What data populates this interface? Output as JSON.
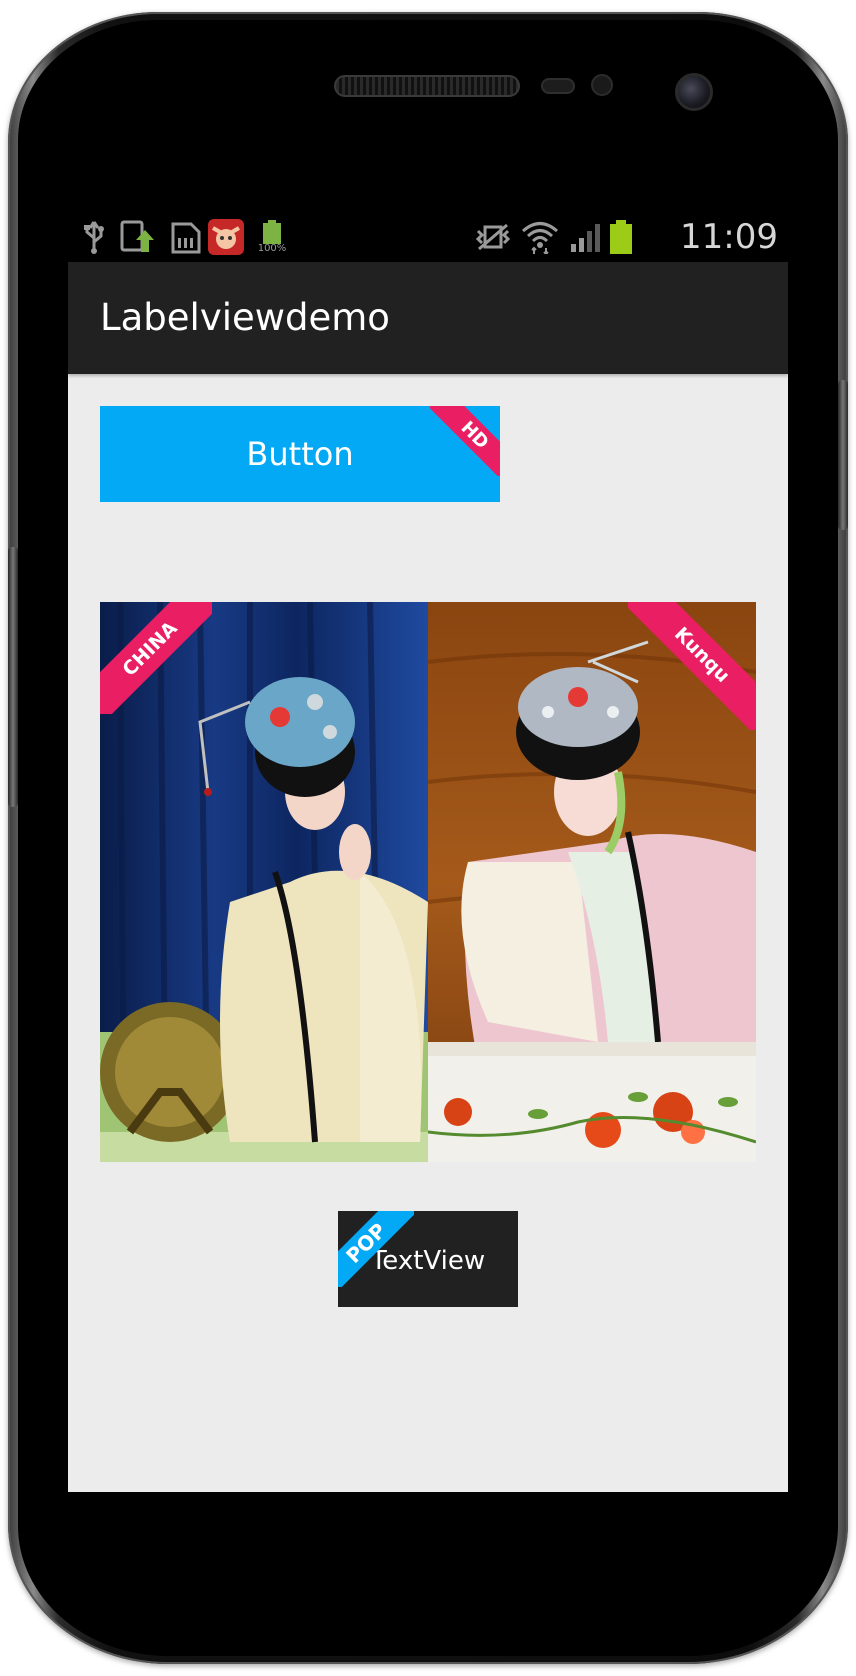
{
  "status_bar": {
    "time": "11:09",
    "battery_left_label": "100%",
    "icons": [
      "usb-icon",
      "upload-icon",
      "sd-card-icon",
      "app-notification-icon",
      "battery-charging-icon",
      "vibrate-icon",
      "wifi-icon",
      "signal-icon",
      "battery-icon"
    ]
  },
  "action_bar": {
    "title": "Labelviewdemo"
  },
  "button": {
    "label": "Button",
    "corner_label": "HD",
    "color": "#03a9f4",
    "label_color": "#e91e63"
  },
  "images": [
    {
      "corner_label": "CHINA",
      "label_color": "#e91e63"
    },
    {
      "corner_label": "Kunqu",
      "label_color": "#e91e63"
    }
  ],
  "textview": {
    "label": "TextView",
    "corner_label": "POP",
    "color": "#212121",
    "label_color": "#03a9f4"
  }
}
